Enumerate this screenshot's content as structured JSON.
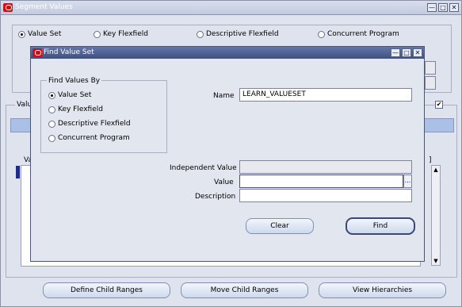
{
  "main_window": {
    "title": "Segment Values",
    "radios": [
      {
        "label": "Value Set",
        "selected": true
      },
      {
        "label": "Key Flexfield",
        "selected": false
      },
      {
        "label": "Descriptive Flexfield",
        "selected": false
      },
      {
        "label": "Concurrent Program",
        "selected": false
      }
    ],
    "values_label_fragment": "Valu",
    "grid_header_fragment": "Va",
    "bracket": "]",
    "bottom_buttons": [
      "Define Child Ranges",
      "Move Child Ranges",
      "View Hierarchies"
    ],
    "window_controls": [
      "—",
      "□",
      "✕"
    ]
  },
  "dialog": {
    "title": "Find Value Set",
    "group_title": "Find Values By",
    "radios": [
      {
        "label": "Value Set",
        "selected": true
      },
      {
        "label": "Key Flexfield",
        "selected": false
      },
      {
        "label": "Descriptive Flexfield",
        "selected": false
      },
      {
        "label": "Concurrent Program",
        "selected": false
      }
    ],
    "name_label": "Name",
    "name_value": "LEARN_VALUESET",
    "independent_value_label": "Independent Value",
    "independent_value": "",
    "value_label": "Value",
    "value_value": "",
    "lov_button": "...",
    "description_label": "Description",
    "description_value": "",
    "clear_button": "Clear",
    "find_button": "Find",
    "window_controls": [
      "—",
      "□",
      "✕"
    ]
  },
  "icons": {
    "oracle": "oracle-logo-icon",
    "checkbox": "checkbox-icon",
    "scroll_up": "scroll-up-icon",
    "scroll_down": "scroll-down-icon"
  }
}
